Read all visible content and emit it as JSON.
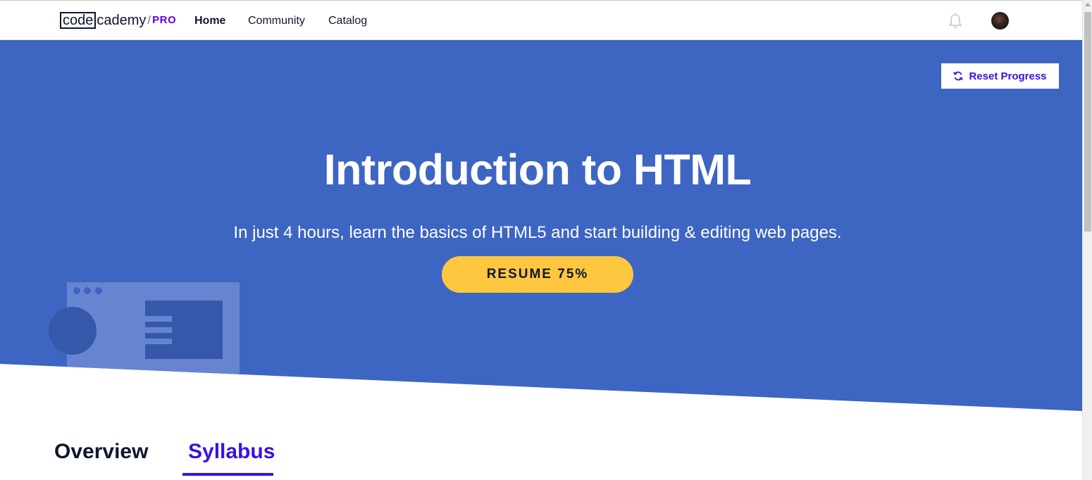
{
  "header": {
    "logo": {
      "code": "code",
      "cademy": "cademy",
      "slash": "/",
      "pro": "PRO"
    },
    "nav": [
      {
        "label": "Home",
        "active": true
      },
      {
        "label": "Community",
        "active": false
      },
      {
        "label": "Catalog",
        "active": false
      }
    ],
    "icons": {
      "notifications": "bell-icon",
      "avatar": "user-avatar"
    }
  },
  "hero": {
    "reset_label": "Reset Progress",
    "reset_icon": "refresh-icon",
    "title": "Introduction to HTML",
    "subtitle": "In just 4 hours, learn the basics of HTML5 and start building & editing web pages.",
    "resume_label": "RESUME 75%",
    "progress_percent": 75
  },
  "tabs": [
    {
      "label": "Overview",
      "active": false
    },
    {
      "label": "Syllabus",
      "active": true
    }
  ],
  "colors": {
    "hero_bg": "#3d65c2",
    "accent": "#3a10e5",
    "resume_btn": "#ffc740",
    "pro": "#6400e4",
    "text_dark": "#10162f"
  }
}
